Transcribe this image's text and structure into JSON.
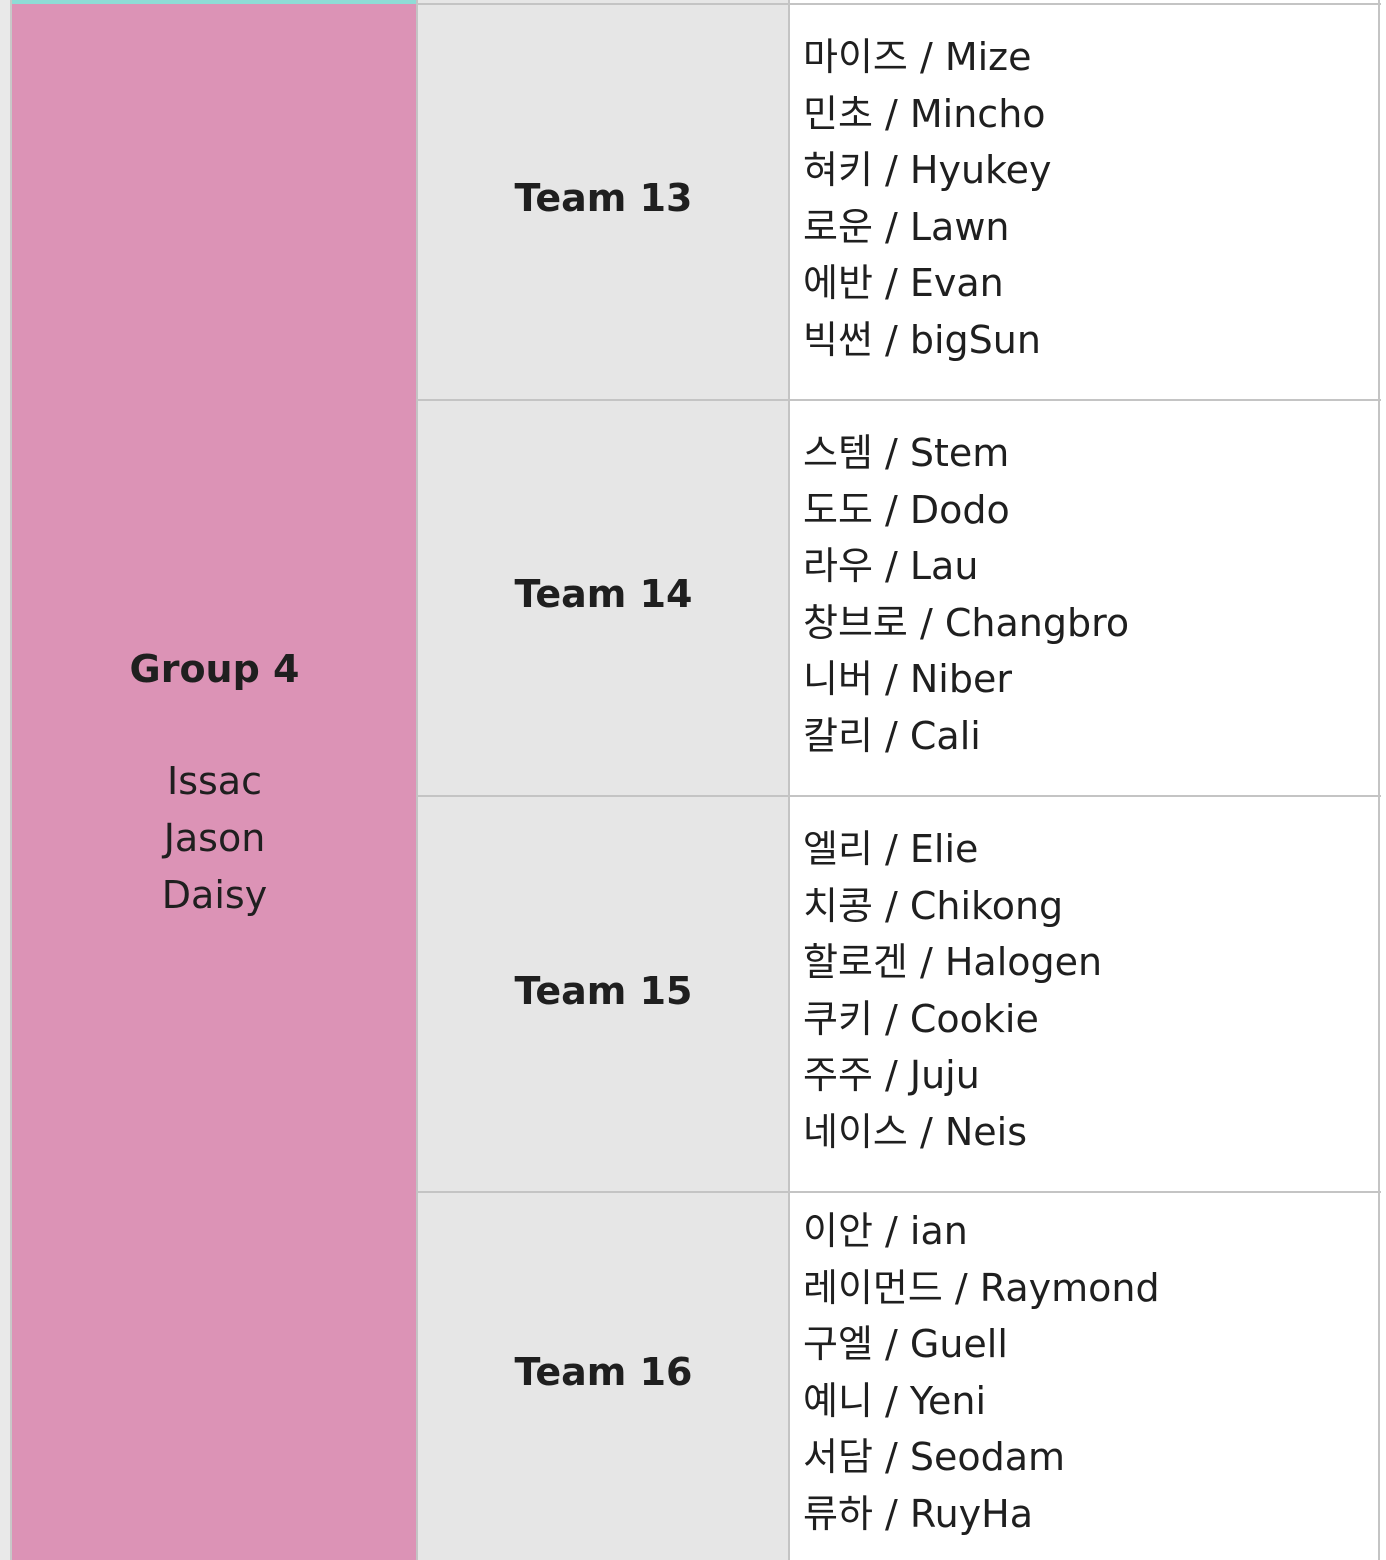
{
  "group": {
    "title": "Group 4",
    "members": [
      "Issac",
      "Jason",
      "Daisy"
    ]
  },
  "teams": [
    {
      "label": "Team 13",
      "members": [
        "마이즈 / Mize",
        "민초 / Mincho",
        "혀키 / Hyukey",
        "로운 / Lawn",
        "에반 / Evan",
        "빅썬 / bigSun"
      ]
    },
    {
      "label": "Team 14",
      "members": [
        "스템 / Stem",
        "도도 / Dodo",
        "라우 / Lau",
        "창브로 / Changbro",
        "니버 / Niber",
        "칼리 / Cali"
      ]
    },
    {
      "label": "Team 15",
      "members": [
        "엘리 / Elie",
        "치콩 / Chikong",
        "할로겐 / Halogen",
        "쿠키 / Cookie",
        "주주 / Juju",
        "네이스 / Neis"
      ]
    },
    {
      "label": "Team 16",
      "members": [
        "이안 / ian",
        "레이먼드 / Raymond",
        "구엘 / Guell",
        "예니 / Yeni",
        "서담 / Seodam",
        "류하 / RuyHa"
      ]
    }
  ],
  "colors": {
    "group_bg": "#dc93b6",
    "team_bg": "#e6e6e6",
    "member_bg": "#ffffff",
    "top_strip": "#8edcd6",
    "grid_line": "#c4c4c4"
  }
}
